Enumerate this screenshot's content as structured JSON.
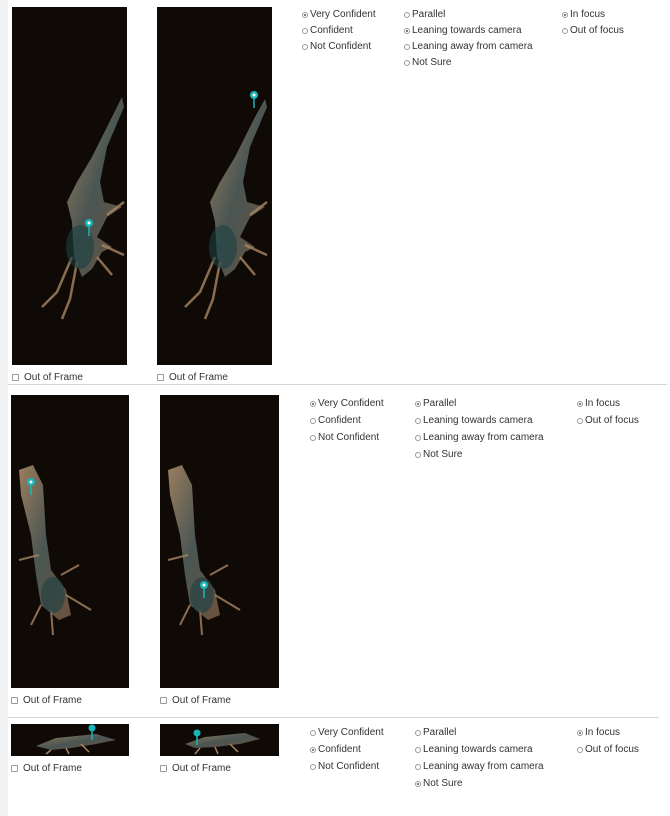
{
  "labels": {
    "out_of_frame": "Out of Frame"
  },
  "confidence_options": [
    "Very Confident",
    "Confident",
    "Not Confident"
  ],
  "orientation_options": [
    "Parallel",
    "Leaning towards camera",
    "Leaning away from camera",
    "Not Sure"
  ],
  "focus_options": [
    "In focus",
    "Out of focus"
  ],
  "icons": {
    "keypoint": "map-pin-icon"
  },
  "colors": {
    "marker": "#19b5b8",
    "image_bg": "#100a07"
  },
  "rows": [
    {
      "confidence": "Very Confident",
      "orientation": "Leaning towards camera",
      "focus": "In focus"
    },
    {
      "confidence": "Very Confident",
      "orientation": "Parallel",
      "focus": "In focus"
    },
    {
      "confidence": "Confident",
      "orientation": "Not Sure",
      "focus": "In focus"
    }
  ]
}
